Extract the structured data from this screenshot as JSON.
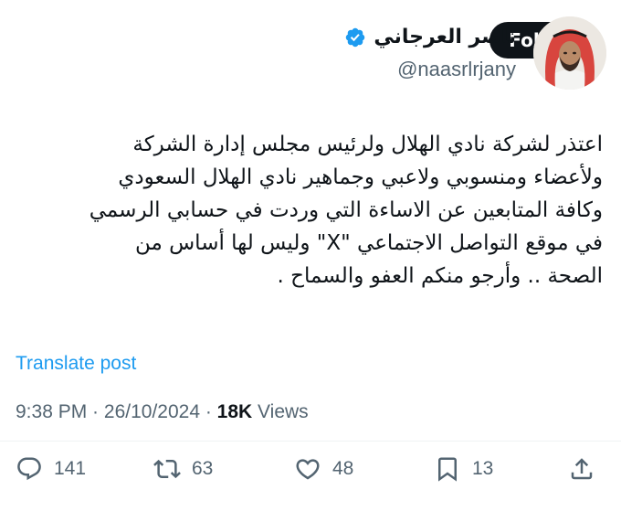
{
  "follow_label": "Follow",
  "author": {
    "display_name": "ناصر العرجاني",
    "handle": "@naasrlrjany",
    "verified": true
  },
  "tweet": {
    "text": "اعتذر لشركة نادي الهلال ولرئيس مجلس إدارة الشركة\nولأعضاء ومنسوبي ولاعبي وجماهير نادي الهلال السعودي\nوكافة المتابعين عن الاساءة التي وردت في حسابي الرسمي\nفي موقع التواصل الاجتماعي \"X\" وليس لها أساس من\nالصحة .. وأرجو منكم العفو والسماح ."
  },
  "translate_label": "Translate post",
  "meta": {
    "time": "9:38 PM",
    "separator": " · ",
    "date": "26/10/2024",
    "views_count": "18K",
    "views_label": " Views"
  },
  "actions": {
    "replies": "141",
    "reposts": "63",
    "likes": "48",
    "bookmarks": "13"
  },
  "colors": {
    "link": "#1d9bf0",
    "muted": "#536471",
    "text": "#0f1419",
    "follow_bg": "#0f1419"
  },
  "icons": [
    "verified-badge-icon",
    "reply-icon",
    "repost-icon",
    "like-icon",
    "bookmark-icon",
    "share-icon"
  ]
}
